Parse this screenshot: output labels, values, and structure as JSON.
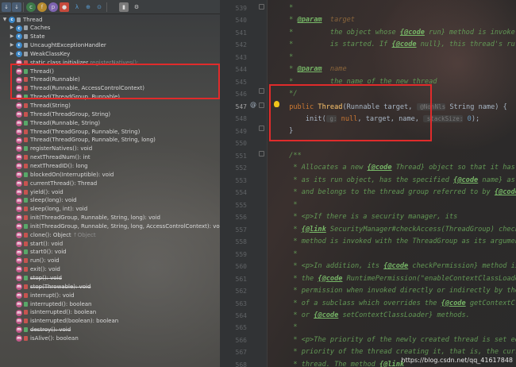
{
  "toolbar": {
    "buttons": [
      "sort-alpha",
      "sort-visibility",
      "show-inherited",
      "show-fields",
      "show-nonpublic",
      "show-lambdas",
      "expand-all",
      "autoscroll",
      "settings"
    ]
  },
  "tree": [
    {
      "indent": 0,
      "arrow": "▼",
      "icon": "c",
      "text": "Thread",
      "hint": ""
    },
    {
      "indent": 1,
      "arrow": "▶",
      "icon": "c",
      "text": "Caches",
      "hint": ""
    },
    {
      "indent": 1,
      "arrow": "▶",
      "icon": "c",
      "text": "State",
      "hint": ""
    },
    {
      "indent": 1,
      "arrow": "▶",
      "icon": "c",
      "text": "UncaughtExceptionHandler",
      "hint": ""
    },
    {
      "indent": 1,
      "arrow": "▶",
      "icon": "c",
      "text": "WeakClassKey",
      "hint": ""
    },
    {
      "indent": 1,
      "arrow": "",
      "icon": "m",
      "text": "static class initializer",
      "hint": " registerNatives();"
    },
    {
      "indent": 1,
      "arrow": "",
      "icon": "m",
      "text": "Thread()",
      "hint": ""
    },
    {
      "indent": 1,
      "arrow": "",
      "icon": "m",
      "text": "Thread(Runnable)",
      "hint": ""
    },
    {
      "indent": 1,
      "arrow": "",
      "icon": "m",
      "text": "Thread(Runnable, AccessControlContext)",
      "hint": ""
    },
    {
      "indent": 1,
      "arrow": "",
      "icon": "m",
      "text": "Thread(ThreadGroup, Runnable)",
      "hint": ""
    },
    {
      "indent": 1,
      "arrow": "",
      "icon": "m",
      "text": "Thread(String)",
      "hint": ""
    },
    {
      "indent": 1,
      "arrow": "",
      "icon": "m",
      "text": "Thread(ThreadGroup, String)",
      "hint": ""
    },
    {
      "indent": 1,
      "arrow": "",
      "icon": "m",
      "text": "Thread(Runnable, String)",
      "hint": ""
    },
    {
      "indent": 1,
      "arrow": "",
      "icon": "m",
      "text": "Thread(ThreadGroup, Runnable, String)",
      "hint": ""
    },
    {
      "indent": 1,
      "arrow": "",
      "icon": "m",
      "text": "Thread(ThreadGroup, Runnable, String, long)",
      "hint": ""
    },
    {
      "indent": 1,
      "arrow": "",
      "icon": "m",
      "text": "registerNatives(): void",
      "hint": ""
    },
    {
      "indent": 1,
      "arrow": "",
      "icon": "m",
      "text": "nextThreadNum(): int",
      "hint": ""
    },
    {
      "indent": 1,
      "arrow": "",
      "icon": "m",
      "text": "nextThreadID(): long",
      "hint": ""
    },
    {
      "indent": 1,
      "arrow": "",
      "icon": "m",
      "text": "blockedOn(Interruptible): void",
      "hint": ""
    },
    {
      "indent": 1,
      "arrow": "",
      "icon": "m",
      "text": "currentThread(): Thread",
      "hint": ""
    },
    {
      "indent": 1,
      "arrow": "",
      "icon": "m",
      "text": "yield(): void",
      "hint": ""
    },
    {
      "indent": 1,
      "arrow": "",
      "icon": "m",
      "text": "sleep(long): void",
      "hint": ""
    },
    {
      "indent": 1,
      "arrow": "",
      "icon": "m",
      "text": "sleep(long, int): void",
      "hint": ""
    },
    {
      "indent": 1,
      "arrow": "",
      "icon": "m",
      "text": "init(ThreadGroup, Runnable, String, long): void",
      "hint": ""
    },
    {
      "indent": 1,
      "arrow": "",
      "icon": "m",
      "text": "init(ThreadGroup, Runnable, String, long, AccessControlContext): void",
      "hint": ""
    },
    {
      "indent": 1,
      "arrow": "",
      "icon": "m",
      "text": "clone(): Object",
      "hint": " ↑Object"
    },
    {
      "indent": 1,
      "arrow": "",
      "icon": "m",
      "text": "start(): void",
      "hint": ""
    },
    {
      "indent": 1,
      "arrow": "",
      "icon": "m",
      "text": "start0(): void",
      "hint": ""
    },
    {
      "indent": 1,
      "arrow": "",
      "icon": "m",
      "text": "run(): void",
      "hint": ""
    },
    {
      "indent": 1,
      "arrow": "",
      "icon": "m",
      "text": "exit(): void",
      "hint": ""
    },
    {
      "indent": 1,
      "arrow": "",
      "icon": "m",
      "text": "stop(): void",
      "hint": "",
      "strike": true
    },
    {
      "indent": 1,
      "arrow": "",
      "icon": "m",
      "text": "stop(Throwable): void",
      "hint": "",
      "strike": true
    },
    {
      "indent": 1,
      "arrow": "",
      "icon": "m",
      "text": "interrupt(): void",
      "hint": ""
    },
    {
      "indent": 1,
      "arrow": "",
      "icon": "m",
      "text": "interrupted(): boolean",
      "hint": ""
    },
    {
      "indent": 1,
      "arrow": "",
      "icon": "m",
      "text": "isInterrupted(): boolean",
      "hint": ""
    },
    {
      "indent": 1,
      "arrow": "",
      "icon": "m",
      "text": "isInterrupted(boolean): boolean",
      "hint": ""
    },
    {
      "indent": 1,
      "arrow": "",
      "icon": "m",
      "text": "destroy(): void",
      "hint": "",
      "strike": true
    },
    {
      "indent": 1,
      "arrow": "",
      "icon": "m",
      "text": "isAlive(): boolean",
      "hint": ""
    }
  ],
  "line_numbers": [
    "539",
    "540",
    "541",
    "542",
    "543",
    "544",
    "545",
    "546",
    "547",
    "548",
    "549",
    "550",
    "551",
    "552",
    "553",
    "554",
    "555",
    "556",
    "557",
    "558",
    "559",
    "560",
    "561",
    "562",
    "563",
    "564",
    "565",
    "566",
    "567",
    "568"
  ],
  "current_line": "547",
  "code": [
    [
      {
        "t": " *",
        "c": "doc"
      }
    ],
    [
      {
        "t": " * ",
        "c": "doc"
      },
      {
        "t": "@param",
        "c": "tag"
      },
      {
        "t": "  target",
        "c": "tagp"
      }
    ],
    [
      {
        "t": " *         the object whose ",
        "c": "doc"
      },
      {
        "t": "{@code",
        "c": "tag"
      },
      {
        "t": " run}",
        "c": "doc"
      },
      {
        "t": " method is invoke",
        "c": "doc"
      }
    ],
    [
      {
        "t": " *         is started. If ",
        "c": "doc"
      },
      {
        "t": "{@code",
        "c": "tag"
      },
      {
        "t": " null}, this thread's ru",
        "c": "doc"
      }
    ],
    [
      {
        "t": " *",
        "c": "doc"
      }
    ],
    [
      {
        "t": " * ",
        "c": "doc"
      },
      {
        "t": "@param",
        "c": "tag"
      },
      {
        "t": "  name",
        "c": "tagp"
      }
    ],
    [
      {
        "t": " *         the name of the new thread",
        "c": "doc"
      }
    ],
    [
      {
        "t": " */",
        "c": "doc"
      }
    ],
    [
      {
        "t": " ",
        "c": ""
      },
      {
        "t": "public ",
        "c": "kw"
      },
      {
        "t": "Thread",
        "c": "fn"
      },
      {
        "t": "(Runnable target, ",
        "c": ""
      },
      {
        "t": " @NonNls",
        "c": "hint2"
      },
      {
        "t": " String name) {",
        "c": ""
      }
    ],
    [
      {
        "t": "     init(",
        "c": ""
      },
      {
        "t": " g:",
        "c": "hint2"
      },
      {
        "t": " ",
        "c": ""
      },
      {
        "t": "null",
        "c": "kw"
      },
      {
        "t": ", target, name, ",
        "c": ""
      },
      {
        "t": " stackSize:",
        "c": "hint2"
      },
      {
        "t": " ",
        "c": ""
      },
      {
        "t": "0",
        "c": "num"
      },
      {
        "t": ");",
        "c": ""
      }
    ],
    [
      {
        "t": " }",
        "c": ""
      }
    ],
    [
      {
        "t": "",
        "c": ""
      }
    ],
    [
      {
        "t": " /**",
        "c": "doc"
      }
    ],
    [
      {
        "t": "  * Allocates a new ",
        "c": "doc"
      },
      {
        "t": "{@code",
        "c": "tag"
      },
      {
        "t": " Thread}",
        "c": "doc"
      },
      {
        "t": " object so that it has",
        "c": "doc"
      }
    ],
    [
      {
        "t": "  * as its run object, has the specified ",
        "c": "doc"
      },
      {
        "t": "{@code",
        "c": "tag"
      },
      {
        "t": " name}",
        "c": "doc"
      },
      {
        "t": " as",
        "c": "doc"
      }
    ],
    [
      {
        "t": "  * and belongs to the thread group referred to by ",
        "c": "doc"
      },
      {
        "t": "{@code",
        "c": "tag"
      }
    ],
    [
      {
        "t": "  *",
        "c": "doc"
      }
    ],
    [
      {
        "t": "  * <p>If there is a security manager, its",
        "c": "doc"
      }
    ],
    [
      {
        "t": "  * ",
        "c": "doc"
      },
      {
        "t": "{@link",
        "c": "tag"
      },
      {
        "t": " SecurityManager#checkAccess(ThreadGroup)",
        "c": "doc"
      },
      {
        "t": " check",
        "c": "doc"
      }
    ],
    [
      {
        "t": "  * method is invoked with the ThreadGroup as its argumen",
        "c": "doc"
      }
    ],
    [
      {
        "t": "  *",
        "c": "doc"
      }
    ],
    [
      {
        "t": "  * <p>In addition, its ",
        "c": "doc"
      },
      {
        "t": "{@code",
        "c": "tag"
      },
      {
        "t": " checkPermission}",
        "c": "doc"
      },
      {
        "t": " method is",
        "c": "doc"
      }
    ],
    [
      {
        "t": "  * the ",
        "c": "doc"
      },
      {
        "t": "{@code",
        "c": "tag"
      },
      {
        "t": " RuntimePermission(\"enableContextClassLoade",
        "c": "doc"
      }
    ],
    [
      {
        "t": "  * permission when invoked directly or indirectly by the",
        "c": "doc"
      }
    ],
    [
      {
        "t": "  * of a subclass which overrides the ",
        "c": "doc"
      },
      {
        "t": "{@code",
        "c": "tag"
      },
      {
        "t": " getContextC",
        "c": "doc"
      }
    ],
    [
      {
        "t": "  * or ",
        "c": "doc"
      },
      {
        "t": "{@code",
        "c": "tag"
      },
      {
        "t": " setContextClassLoader}",
        "c": "doc"
      },
      {
        "t": " methods.",
        "c": "doc"
      }
    ],
    [
      {
        "t": "  *",
        "c": "doc"
      }
    ],
    [
      {
        "t": "  * <p>The priority of the newly created thread is set eq",
        "c": "doc"
      }
    ],
    [
      {
        "t": "  * priority of the thread creating it, that is, the curr",
        "c": "doc"
      }
    ],
    [
      {
        "t": "  * thread. The method ",
        "c": "doc"
      },
      {
        "t": "{@link",
        "c": "tag"
      }
    ]
  ],
  "watermark": "https://blog.csdn.net/qq_41617848",
  "colors": {
    "highlight_box": "#e02b2b",
    "keyword": "#cc7832",
    "doc_comment": "#629755"
  }
}
